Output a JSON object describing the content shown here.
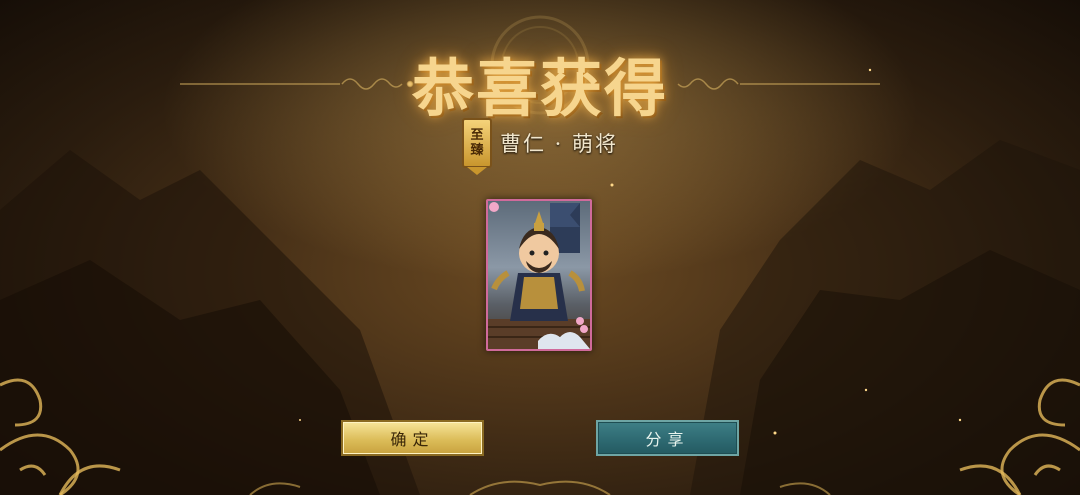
{
  "dialog": {
    "title": "恭喜获得",
    "badge": {
      "line1": "至",
      "line2": "臻"
    },
    "card_name": "曹仁 · 萌将"
  },
  "buttons": {
    "confirm_label": "确定",
    "share_label": "分享"
  },
  "colors": {
    "title_gold": "#f6d58e",
    "confirm_gold": "#dcbd5a",
    "share_teal": "#2e6a72",
    "card_border_pink": "#d06a9b"
  }
}
